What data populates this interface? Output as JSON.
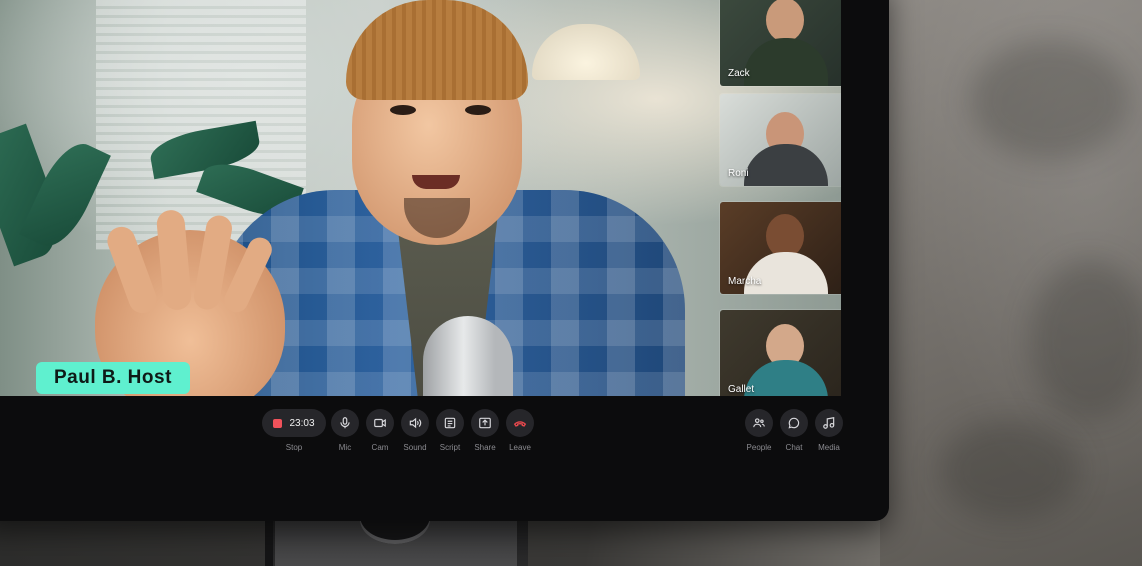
{
  "host": {
    "name": "Paul B. Host"
  },
  "participants": [
    {
      "name": "Zack"
    },
    {
      "name": "Roni"
    },
    {
      "name": "Marcha"
    },
    {
      "name": "Gallet"
    }
  ],
  "controls": {
    "timer": "23:03",
    "stop_label": "Stop",
    "mic_label": "Mic",
    "cam_label": "Cam",
    "sound_label": "Sound",
    "script_label": "Script",
    "share_label": "Share",
    "leave_label": "Leave",
    "people_label": "People",
    "chat_label": "Chat",
    "media_label": "Media"
  },
  "colors": {
    "name_tag": "#5ff0cf",
    "record": "#f0525b",
    "leave": "#e5484d"
  },
  "icons": {
    "stop": "stop-icon",
    "mic": "mic-icon",
    "cam": "camera-icon",
    "sound": "speaker-icon",
    "script": "script-icon",
    "share": "share-icon",
    "leave": "phone-hangup-icon",
    "people": "people-icon",
    "chat": "chat-icon",
    "media": "music-icon"
  }
}
